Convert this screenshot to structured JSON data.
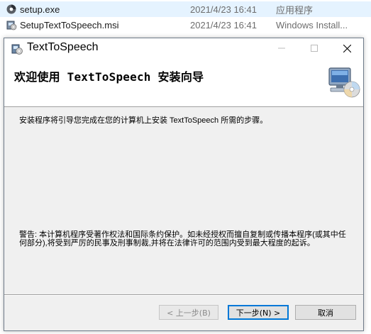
{
  "files": [
    {
      "name": "setup.exe",
      "date": "2021/4/23 16:41",
      "type": "应用程序",
      "icon": "setup-exe-icon"
    },
    {
      "name": "SetupTextToSpeech.msi",
      "date": "2021/4/23 16:41",
      "type": "Windows Install...",
      "icon": "msi-installer-icon"
    }
  ],
  "dialog": {
    "title": "TextToSpeech",
    "banner_title": "欢迎使用 TextToSpeech 安装向导",
    "intro": "安装程序将引导您完成在您的计算机上安装 TextToSpeech 所需的步骤。",
    "warning": "警告: 本计算机程序受著作权法和国际条约保护。如未经授权而擅自复制或传播本程序(或其中任何部分),将受到严厉的民事及刑事制裁,并将在法律许可的范围内受到最大程度的起诉。",
    "buttons": {
      "back": "< 上一步(B)",
      "next": "下一步(N) >",
      "cancel": "取消"
    }
  },
  "colors": {
    "selection": "#e5f3ff",
    "accent": "#0078d7",
    "dialog_bg": "#f0f0f0"
  }
}
